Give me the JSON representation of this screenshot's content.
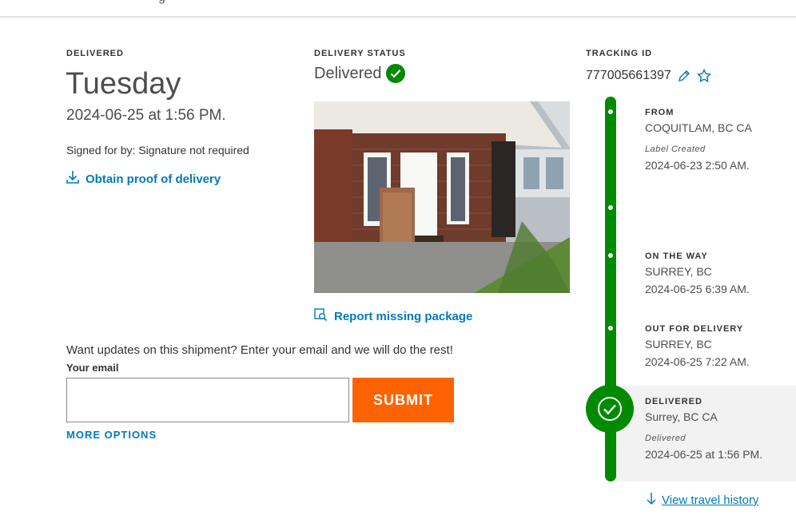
{
  "header": {
    "partial_text": "g"
  },
  "delivery": {
    "status_label": "DELIVERED",
    "day": "Tuesday",
    "datetime": "2024-06-25 at 1:56 PM.",
    "signed_for": "Signed for by: Signature not required",
    "proof_link": "Obtain proof of delivery"
  },
  "status": {
    "label": "DELIVERY STATUS",
    "value": "Delivered",
    "report_link": "Report missing package"
  },
  "tracking": {
    "label": "TRACKING ID",
    "id": "777005661397"
  },
  "timeline": [
    {
      "label": "FROM",
      "location": "COQUITLAM, BC CA",
      "note": "Label Created",
      "time": "2024-06-23 2:50 AM."
    },
    {
      "label": "ON THE WAY",
      "location": "SURREY, BC",
      "time": "2024-06-25 6:39 AM."
    },
    {
      "label": "OUT FOR DELIVERY",
      "location": "SURREY, BC",
      "time": "2024-06-25 7:22 AM."
    },
    {
      "label": "DELIVERED",
      "location": "Surrey, BC CA",
      "note": "Delivered",
      "time": "2024-06-25 at 1:56 PM."
    }
  ],
  "updates": {
    "prompt": "Want updates on this shipment? Enter your email and we will do the rest!",
    "email_label": "Your email",
    "email_value": "",
    "submit_label": "SUBMIT",
    "more_options": "MORE OPTIONS"
  },
  "history_link": "View travel history",
  "colors": {
    "green": "#008a00",
    "blue": "#007ab7",
    "orange": "#ff6200"
  },
  "icons": [
    "download-icon",
    "check-circle-icon",
    "search-package-icon",
    "pencil-icon",
    "star-icon",
    "arrow-down-icon"
  ]
}
